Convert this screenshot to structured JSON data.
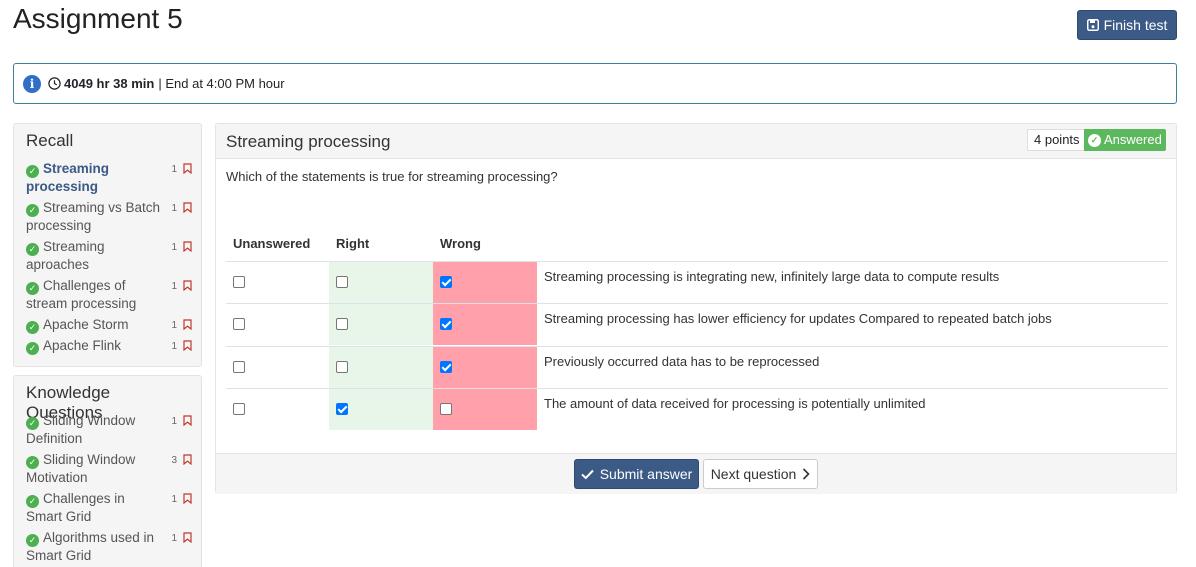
{
  "page": {
    "title": "Assignment 5",
    "finish_label": "Finish test"
  },
  "timer": {
    "remaining": "4049 hr 38 min",
    "separator": "|",
    "end_text": "End at 4:00 PM hour"
  },
  "recall": {
    "heading": "Recall",
    "items": [
      {
        "label": "Streaming processing",
        "count": "1",
        "active": true
      },
      {
        "label": "Streaming vs Batch processing",
        "count": "1"
      },
      {
        "label": "Streaming aproaches",
        "count": "1"
      },
      {
        "label": "Challenges of stream processing",
        "count": "1"
      },
      {
        "label": "Apache Storm",
        "count": "1"
      },
      {
        "label": "Apache Flink",
        "count": "1"
      }
    ]
  },
  "knowledge": {
    "heading": "Knowledge Questions",
    "items": [
      {
        "label": "Sliding Window Definition",
        "count": "1"
      },
      {
        "label": "Sliding Window Motivation",
        "count": "3"
      },
      {
        "label": "Challenges in Smart Grid",
        "count": "1"
      },
      {
        "label": "Algorithms used in Smart Grid",
        "count": "1"
      }
    ]
  },
  "question": {
    "title": "Streaming processing",
    "points": "4 points",
    "status": "Answered",
    "text": "Which of the statements is true for streaming processing?",
    "columns": {
      "unanswered": "Unanswered",
      "right": "Right",
      "wrong": "Wrong"
    },
    "rows": [
      {
        "statement": "Streaming processing is integrating new, infinitely large data to compute results",
        "unanswered": false,
        "right": false,
        "wrong": true
      },
      {
        "statement": "Streaming processing has lower efficiency for updates Compared to repeated batch jobs",
        "unanswered": false,
        "right": false,
        "wrong": true
      },
      {
        "statement": "Previously occurred data has to be reprocessed",
        "unanswered": false,
        "right": false,
        "wrong": true
      },
      {
        "statement": "The amount of data received for processing is potentially unlimited",
        "unanswered": false,
        "right": true,
        "wrong": false
      }
    ]
  },
  "footer": {
    "submit_label": "Submit answer",
    "next_label": "Next question"
  },
  "colors": {
    "primary": "#3b5a85",
    "success": "#5cb85c",
    "right_cell": "#e8f5e9",
    "wrong_cell": "#ffa0ab"
  }
}
